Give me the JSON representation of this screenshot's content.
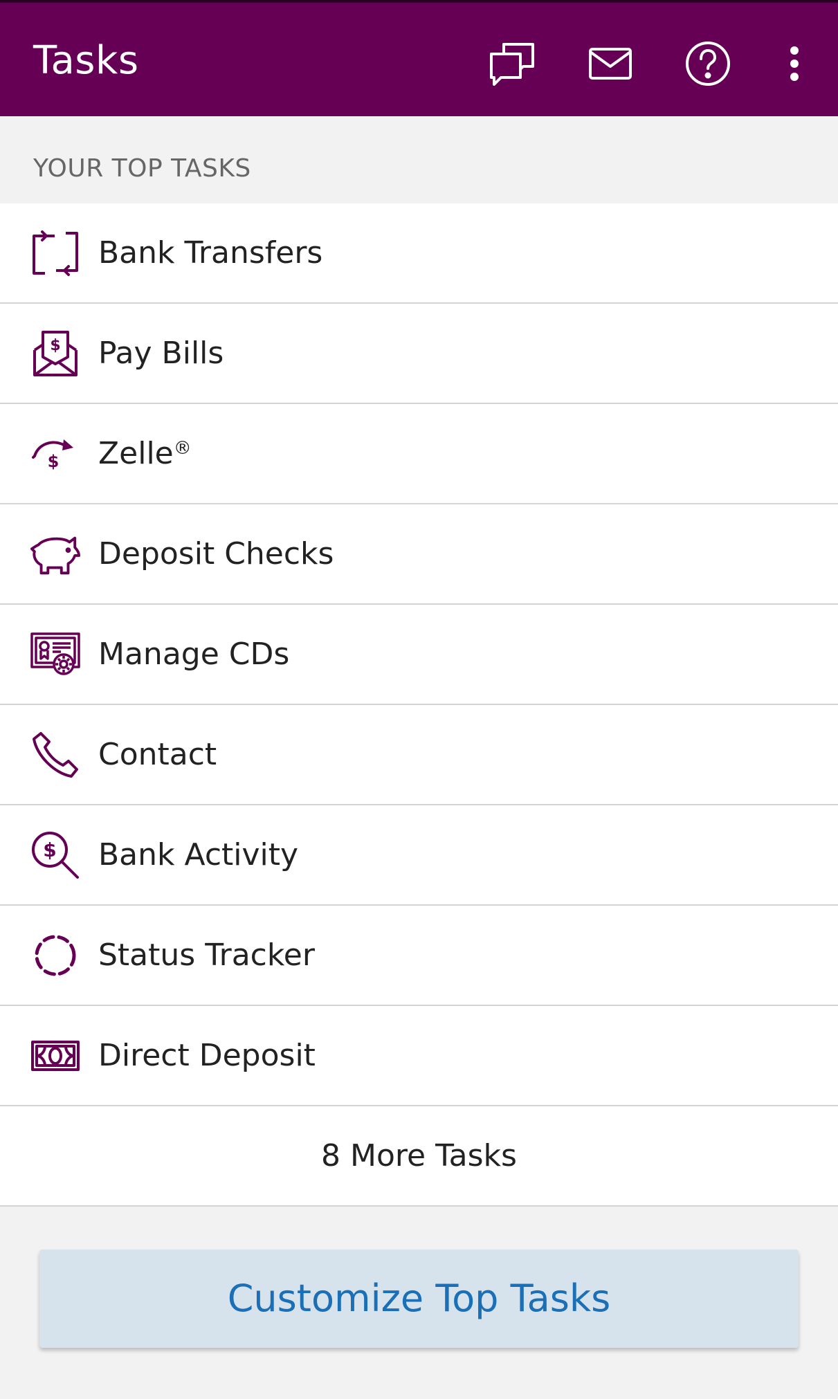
{
  "app_bar": {
    "title": "Tasks",
    "icons": [
      "chat-icon",
      "mail-icon",
      "help-icon",
      "more-vertical-icon"
    ],
    "background_color": "#660055"
  },
  "section": {
    "header": "YOUR TOP TASKS"
  },
  "tasks": [
    {
      "label": "Bank Transfers",
      "icon": "transfer-icon"
    },
    {
      "label": "Pay Bills",
      "icon": "pay-bills-icon"
    },
    {
      "label": "Zelle",
      "suffix": "®",
      "icon": "zelle-icon"
    },
    {
      "label": "Deposit Checks",
      "icon": "piggy-bank-icon"
    },
    {
      "label": "Manage CDs",
      "icon": "certificate-icon"
    },
    {
      "label": "Contact",
      "icon": "phone-icon"
    },
    {
      "label": "Bank Activity",
      "icon": "dollar-search-icon"
    },
    {
      "label": "Status Tracker",
      "icon": "status-tracker-icon"
    },
    {
      "label": "Direct Deposit",
      "icon": "cash-bill-icon"
    }
  ],
  "more_tasks": {
    "label": "8 More Tasks"
  },
  "customize_button": {
    "label": "Customize Top Tasks",
    "text_color": "#1a6fb6",
    "background_color": "#d7e3ec"
  },
  "colors": {
    "icon_purple": "#660055",
    "text_dark": "#222222",
    "header_gray": "#666666"
  }
}
